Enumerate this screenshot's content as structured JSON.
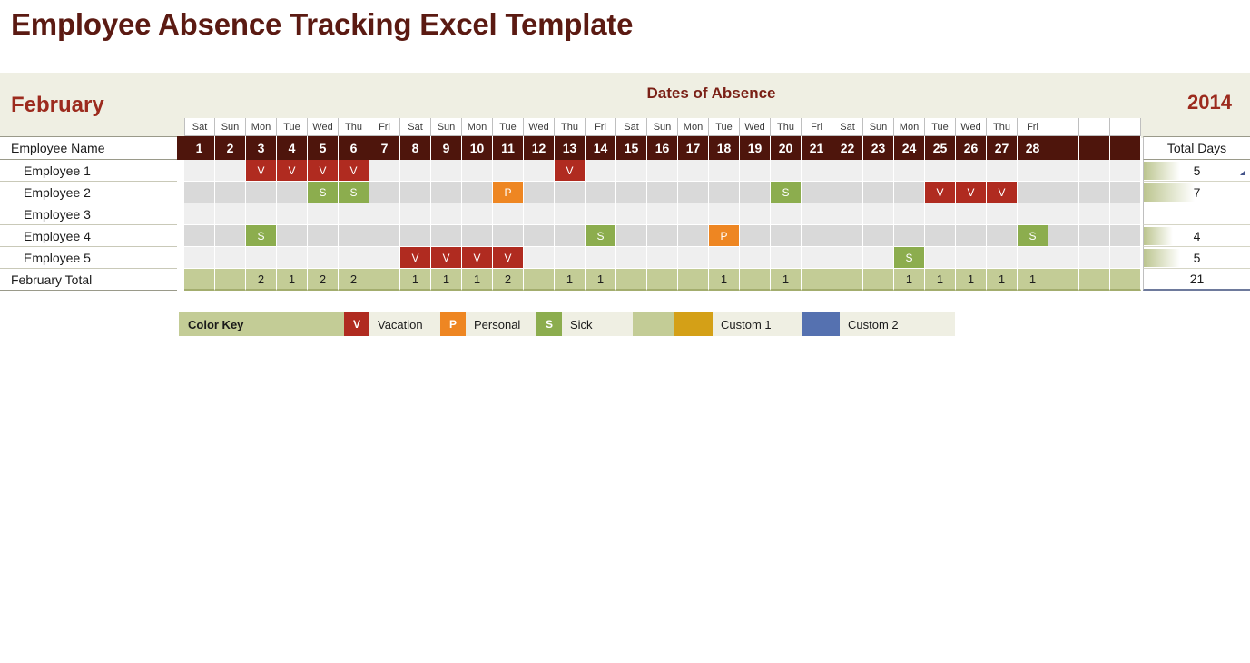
{
  "title": "Employee Absence Tracking Excel Template",
  "banner": {
    "month": "February",
    "center_label": "Dates of Absence",
    "year": "2014"
  },
  "table": {
    "name_header": "Employee Name",
    "total_days_header": "Total Days",
    "total_row_label": "February Total",
    "weekdays": [
      "Sat",
      "Sun",
      "Mon",
      "Tue",
      "Wed",
      "Thu",
      "Fri",
      "Sat",
      "Sun",
      "Mon",
      "Tue",
      "Wed",
      "Thu",
      "Fri",
      "Sat",
      "Sun",
      "Mon",
      "Tue",
      "Wed",
      "Thu",
      "Fri",
      "Sat",
      "Sun",
      "Mon",
      "Tue",
      "Wed",
      "Thu",
      "Fri",
      "",
      "",
      ""
    ],
    "dates": [
      "1",
      "2",
      "3",
      "4",
      "5",
      "6",
      "7",
      "8",
      "9",
      "10",
      "11",
      "12",
      "13",
      "14",
      "15",
      "16",
      "17",
      "18",
      "19",
      "20",
      "21",
      "22",
      "23",
      "24",
      "25",
      "26",
      "27",
      "28",
      "",
      "",
      ""
    ],
    "employees": [
      {
        "name": "Employee 1",
        "total_days": "5",
        "bar_pct": 40,
        "cells": [
          "",
          "",
          "V",
          "V",
          "V",
          "V",
          "",
          "",
          "",
          "",
          "",
          "",
          "V",
          "",
          "",
          "",
          "",
          "",
          "",
          "",
          "",
          "",
          "",
          "",
          "",
          "",
          "",
          "",
          "",
          "",
          ""
        ]
      },
      {
        "name": "Employee 2",
        "total_days": "7",
        "bar_pct": 56,
        "cells": [
          "",
          "",
          "",
          "",
          "S",
          "S",
          "",
          "",
          "",
          "",
          "P",
          "",
          "",
          "",
          "",
          "",
          "",
          "",
          "",
          "S",
          "",
          "",
          "",
          "",
          "V",
          "V",
          "V",
          "",
          "",
          "",
          ""
        ]
      },
      {
        "name": "Employee 3",
        "total_days": "",
        "bar_pct": 0,
        "cells": [
          "",
          "",
          "",
          "",
          "",
          "",
          "",
          "",
          "",
          "",
          "",
          "",
          "",
          "",
          "",
          "",
          "",
          "",
          "",
          "",
          "",
          "",
          "",
          "",
          "",
          "",
          "",
          "",
          "",
          "",
          ""
        ]
      },
      {
        "name": "Employee 4",
        "total_days": "4",
        "bar_pct": 32,
        "cells": [
          "",
          "",
          "S",
          "",
          "",
          "",
          "",
          "",
          "",
          "",
          "",
          "",
          "",
          "S",
          "",
          "",
          "",
          "P",
          "",
          "",
          "",
          "",
          "",
          "",
          "",
          "",
          "",
          "S",
          "",
          "",
          ""
        ]
      },
      {
        "name": "Employee 5",
        "total_days": "5",
        "bar_pct": 40,
        "cells": [
          "",
          "",
          "",
          "",
          "",
          "",
          "",
          "V",
          "V",
          "V",
          "V",
          "",
          "",
          "",
          "",
          "",
          "",
          "",
          "",
          "",
          "",
          "",
          "",
          "S",
          "",
          "",
          "",
          "",
          "",
          "",
          ""
        ]
      }
    ],
    "totals": {
      "per_day": [
        "",
        "",
        "2",
        "1",
        "2",
        "2",
        "",
        "1",
        "1",
        "1",
        "2",
        "",
        "1",
        "1",
        "",
        "",
        "",
        "1",
        "",
        "1",
        "",
        "",
        "",
        "1",
        "1",
        "1",
        "1",
        "1",
        "",
        "",
        ""
      ],
      "grand_total": "21"
    }
  },
  "color_key": {
    "title": "Color Key",
    "items": [
      {
        "code": "V",
        "label": "Vacation",
        "color": "#B02B20",
        "cls": "v"
      },
      {
        "code": "P",
        "label": "Personal",
        "color": "#EE8622",
        "cls": "p"
      },
      {
        "code": "S",
        "label": "Sick",
        "color": "#8CAD4E",
        "cls": "s"
      },
      {
        "code": "",
        "label": "Custom 1",
        "color": "#D4A017",
        "cls": "c1"
      },
      {
        "code": "",
        "label": "Custom 2",
        "color": "#5571B0",
        "cls": "c2"
      }
    ]
  }
}
